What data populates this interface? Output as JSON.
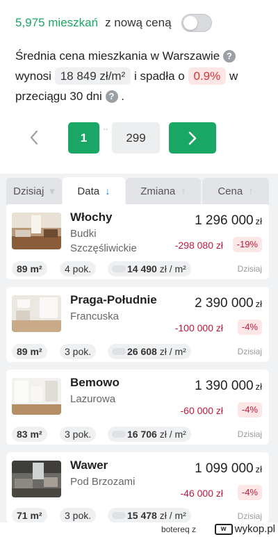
{
  "header": {
    "count": "5,975 mieszkań",
    "count_suffix": "z nową ceną",
    "toggle_on": false
  },
  "summary": {
    "line1": "Średnia cena mieszkania w Warszawie",
    "wynosi": "wynosi",
    "avg_price": "18 849 zł/m²",
    "fell": "i spadła o",
    "drop_pct": "0.9%",
    "in": "w",
    "period": "przeciągu 30 dni",
    "period_end": "."
  },
  "pagination": {
    "prev_icon": "chevron-left-icon",
    "current": "1",
    "dots": "..",
    "last": "299",
    "next_icon": "chevron-right-icon"
  },
  "sort": {
    "tabs": [
      {
        "label": "Dzisiaj",
        "arrow": "▾"
      },
      {
        "label": "Data",
        "arrow": "↓"
      },
      {
        "label": "Zmiana",
        "arrow": "↑"
      },
      {
        "label": "Cena",
        "arrow": "↑"
      }
    ],
    "active": 1
  },
  "listings": [
    {
      "district": "Włochy",
      "street": "Budki Szczęśliwickie",
      "price": "1 296 000",
      "currency": "zł",
      "change": "-298 080 zł",
      "pct": "-19%",
      "area": "89 m²",
      "rooms": "4 pok.",
      "ppm": "14 490",
      "ppm_unit": "zł / m²",
      "when": "Dzisiaj"
    },
    {
      "district": "Praga-Południe",
      "street": "Francuska",
      "price": "2 390 000",
      "currency": "zł",
      "change": "-100 000 zł",
      "pct": "-4%",
      "area": "89 m²",
      "rooms": "3 pok.",
      "ppm": "26 608",
      "ppm_unit": "zł / m²",
      "when": "Dzisiaj"
    },
    {
      "district": "Bemowo",
      "street": "Lazurowa",
      "price": "1 390 000",
      "currency": "zł",
      "change": "-60 000 zł",
      "pct": "-4%",
      "area": "83 m²",
      "rooms": "3 pok.",
      "ppm": "16 706",
      "ppm_unit": "zł / m²",
      "when": "Dzisiaj"
    },
    {
      "district": "Wawer",
      "street": "Pod Brzozami",
      "price": "1 099 000",
      "currency": "zł",
      "change": "-46 000 zł",
      "pct": "-4%",
      "area": "71 m²",
      "rooms": "3 pok.",
      "ppm": "15 478",
      "ppm_unit": "zł / m²",
      "when": "Dzisiaj"
    }
  ],
  "footer": {
    "user": "botereq",
    "via": "z",
    "logo": "wykop.pl"
  },
  "colors": {
    "accent": "#1aa765",
    "drop": "#c0193f",
    "sort_active": "#2f7fd8"
  }
}
